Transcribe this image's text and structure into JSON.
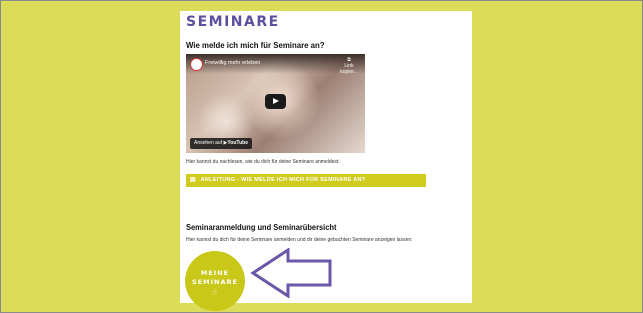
{
  "brand": "SEMINARE",
  "section1": {
    "heading": "Wie melde ich mich für Seminare an?",
    "video": {
      "title": "Freiwillig mehr erleben",
      "share_label": "Link kopier...",
      "watch_on": "Ansehen auf",
      "platform": "YouTube"
    },
    "intro": "Hier kannst du nachlesen, wie du dich für deine Seminare anmeldest:",
    "guide_link": "ANLEITUNG - WIE MELDE ICH MICH FÜR SEMINARE AN?"
  },
  "section2": {
    "heading": "Seminaranmeldung und Seminarübersicht",
    "intro": "Hier kannst du dich für deine Seminare anmelden und dir deine gebuchten Seminare anzeigen lassen:",
    "button_line1": "MEINE",
    "button_line2": "SEMINARE"
  },
  "colors": {
    "background": "#dcdb5a",
    "accent_yellow": "#c9c718",
    "brand_purple": "#5d4e9e",
    "arrow_purple": "#6b56a8"
  },
  "icons": {
    "guide": "document-icon",
    "button": "pointer-hand-icon",
    "annotation": "left-arrow-outline"
  }
}
